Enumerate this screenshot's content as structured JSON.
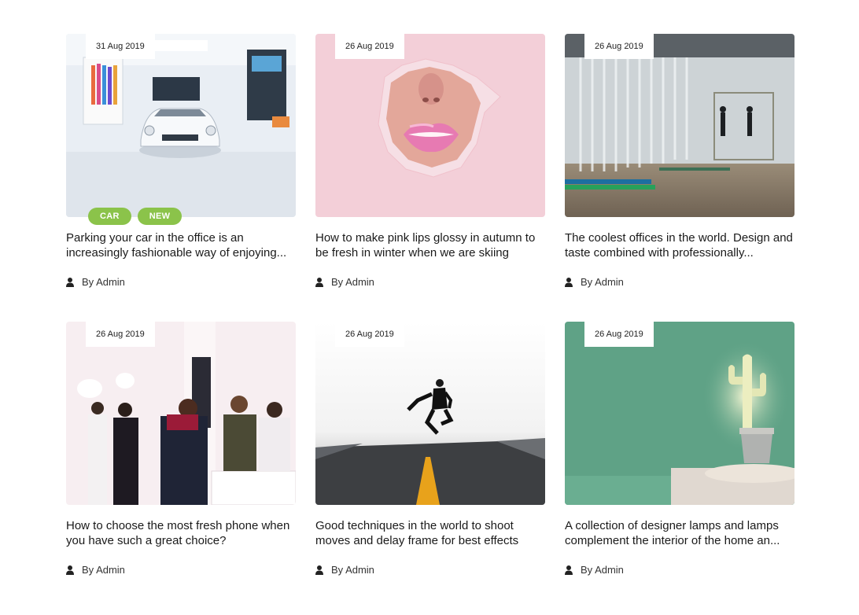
{
  "posts": [
    {
      "date": "31 Aug 2019",
      "tags": [
        "CAR",
        "NEW"
      ],
      "title": "Parking your car in the office is an increasingly fashionable way of enjoying...",
      "author": "By Admin",
      "image_icon": "car-showroom-image"
    },
    {
      "date": "26 Aug 2019",
      "tags": [],
      "title": "How to make pink lips glossy in autumn to be fresh in winter when we are skiing",
      "author": "By Admin",
      "image_icon": "pink-lips-image"
    },
    {
      "date": "26 Aug 2019",
      "tags": [],
      "title": "The coolest offices in the world. Design and taste combined with professionally...",
      "author": "By Admin",
      "image_icon": "office-interior-image"
    },
    {
      "date": "26 Aug 2019",
      "tags": [],
      "title": "How to choose the most fresh phone when you have such a great choice?",
      "author": "By Admin",
      "image_icon": "store-shoppers-image"
    },
    {
      "date": "26 Aug 2019",
      "tags": [],
      "title": "Good techniques in the world to shoot moves and delay frame for best effects",
      "author": "By Admin",
      "image_icon": "jumping-man-road-image"
    },
    {
      "date": "26 Aug 2019",
      "tags": [],
      "title": "A collection of designer lamps and lamps complement the interior of the home an...",
      "author": "By Admin",
      "image_icon": "cactus-lamp-image"
    }
  ],
  "colors": {
    "tag_bg": "#8bc34a",
    "title_text": "#1a1a1a",
    "date_bg": "#ffffff"
  }
}
